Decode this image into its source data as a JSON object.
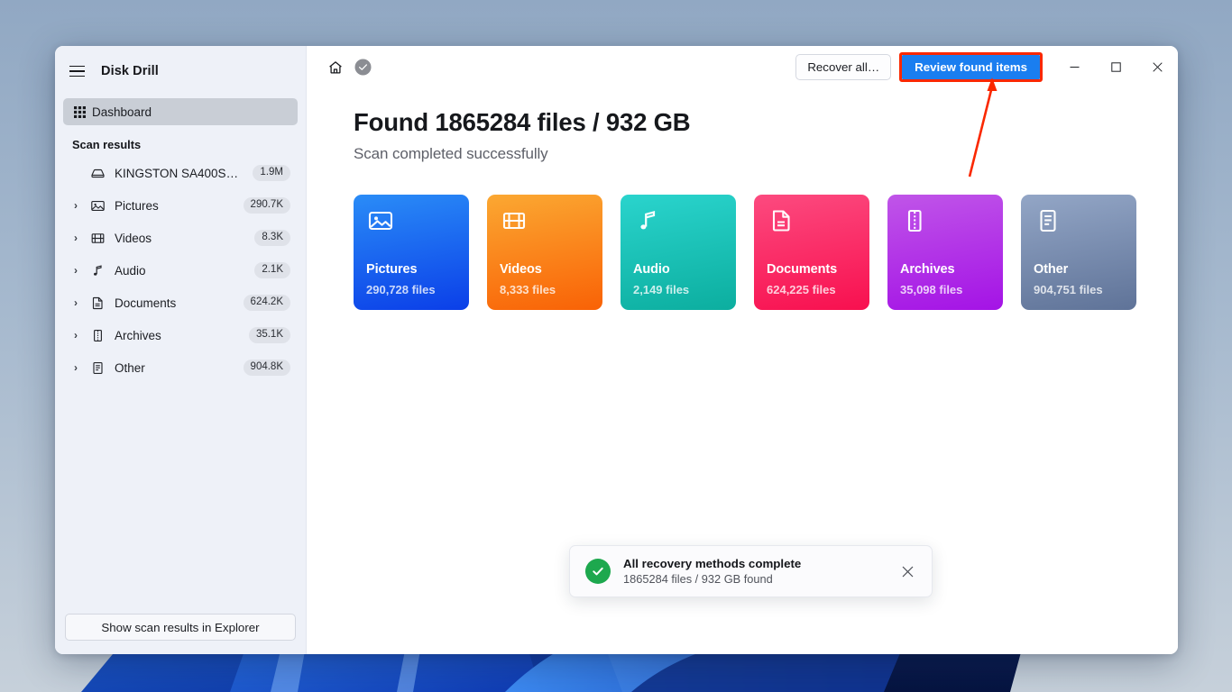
{
  "window": {
    "app_title": "Disk Drill",
    "menu_icon": "hamburger-icon",
    "controls": {
      "minimize": "–",
      "maximize": "□",
      "close": "✕"
    }
  },
  "sidebar": {
    "nav": [
      {
        "label": "Dashboard",
        "icon": "grid-icon",
        "active": true
      }
    ],
    "section_label": "Scan results",
    "tree": [
      {
        "label": "KINGSTON SA400S372...",
        "count": "1.9M",
        "icon": "disk-icon",
        "expandable": false
      },
      {
        "label": "Pictures",
        "count": "290.7K",
        "icon": "image-icon",
        "expandable": true
      },
      {
        "label": "Videos",
        "count": "8.3K",
        "icon": "film-icon",
        "expandable": true
      },
      {
        "label": "Audio",
        "count": "2.1K",
        "icon": "music-note-icon",
        "expandable": true
      },
      {
        "label": "Documents",
        "count": "624.2K",
        "icon": "document-icon",
        "expandable": true
      },
      {
        "label": "Archives",
        "count": "35.1K",
        "icon": "archive-icon",
        "expandable": true
      },
      {
        "label": "Other",
        "count": "904.8K",
        "icon": "file-lines-icon",
        "expandable": true
      }
    ],
    "explorer_button": "Show scan results in Explorer"
  },
  "toolbar": {
    "home_icon": "home-icon",
    "check_icon": "check-circle-icon",
    "recover_all_label": "Recover all…",
    "review_label": "Review found items",
    "review_bg": "#1a7ef0",
    "highlight_color": "#fa2800"
  },
  "main": {
    "headline": "Found 1865284 files / 932 GB",
    "subhead": "Scan completed successfully",
    "cards": [
      {
        "name": "Pictures",
        "count": "290,728 files",
        "icon": "image-icon",
        "from": "#2a8cf7",
        "to": "#0b3fe8"
      },
      {
        "name": "Videos",
        "count": "8,333 files",
        "icon": "film-icon",
        "from": "#fba832",
        "to": "#f96206"
      },
      {
        "name": "Audio",
        "count": "2,149 files",
        "icon": "music-note-icon",
        "from": "#2ad4cd",
        "to": "#0cae9f"
      },
      {
        "name": "Documents",
        "count": "624,225 files",
        "icon": "document-icon",
        "from": "#fc4a7f",
        "to": "#f8104f"
      },
      {
        "name": "Archives",
        "count": "35,098 files",
        "icon": "archive-icon",
        "from": "#c055e8",
        "to": "#a413e6"
      },
      {
        "name": "Other",
        "count": "904,751 files",
        "icon": "file-lines-icon",
        "from": "#93a6c6",
        "to": "#5f7398"
      }
    ]
  },
  "toast": {
    "status_icon": "check-icon",
    "title": "All recovery methods complete",
    "detail": "1865284 files / 932 GB found",
    "close_icon": "close-icon",
    "accent": "#1da84e"
  }
}
